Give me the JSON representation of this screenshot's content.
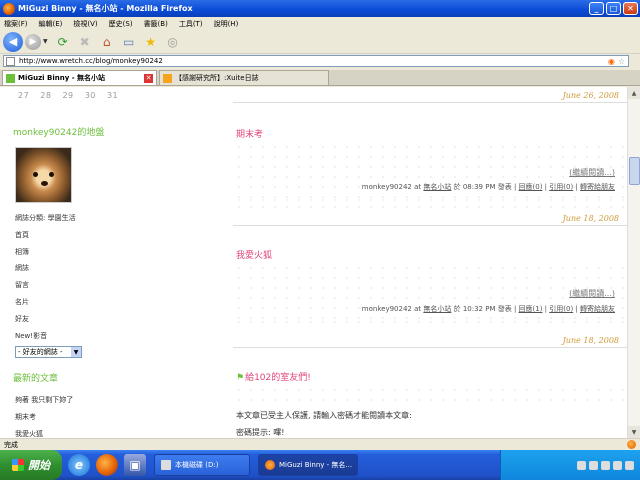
{
  "window": {
    "title": "MiGuzi Binny - 無名小站 - Mozilla Firefox",
    "minimize": "_",
    "maximize": "□",
    "close": "✕"
  },
  "menu": [
    "檔案(F)",
    "編輯(E)",
    "檢視(V)",
    "歷史(S)",
    "書籤(B)",
    "工具(T)",
    "說明(H)"
  ],
  "url": "http://www.wretch.cc/blog/monkey90242",
  "tabs": [
    {
      "label": "MiGuzi Binny - 無名小站",
      "active": true
    },
    {
      "label": "【感謝研究所】:Xuite日誌",
      "active": false
    }
  ],
  "calendar_tail": [
    "27",
    "28",
    "29",
    "30",
    "31"
  ],
  "sidebar": {
    "map_title": "monkey90242的地盤",
    "category": "網誌分類: 學園生活",
    "links": [
      "首頁",
      "相簿",
      "網誌",
      "留言",
      "名片",
      "好友",
      "New!影音"
    ],
    "select_value": "- 好友的網誌 -",
    "recent_title": "最新的文章",
    "recent_posts": [
      "夠著 我只剩下妳了",
      "期末考",
      "我愛火狐"
    ]
  },
  "posts": [
    {
      "date": "June 26, 2008",
      "title": "期末考",
      "readmore": "(繼續閱讀...)",
      "meta_author": "monkey90242",
      "meta_at": "at",
      "meta_site": "無名小站",
      "meta_time": "於 08:39 PM 發表",
      "reply": "回應(0)",
      "cite": "引用(0)",
      "recommend": "轉寄給朋友"
    },
    {
      "date": "June 18, 2008",
      "title": "我愛火狐",
      "readmore": "(繼續閱讀...)",
      "meta_author": "monkey90242",
      "meta_at": "at",
      "meta_site": "無名小站",
      "meta_time": "於 10:32 PM 發表",
      "reply": "回應(1)",
      "cite": "引用(0)",
      "recommend": "轉寄給朋友"
    },
    {
      "date": "June 18, 2008",
      "title": "給102的室友們!",
      "body1": "本文章已受主人保護, 請輸入密碼才能閱讀本文章:",
      "body2": "密碼提示: 嗶!"
    }
  ],
  "status": "完成",
  "taskbar": {
    "start": "開始",
    "task1": "本機磁碟 (D:)",
    "task2": "MiGuzi Binny - 無名..."
  },
  "colors": {
    "title_blue": "#0a4bd6",
    "post_title_pink": "#e0457b",
    "sidebar_green": "#6bbf3a",
    "date_gold": "#d09a3a"
  }
}
